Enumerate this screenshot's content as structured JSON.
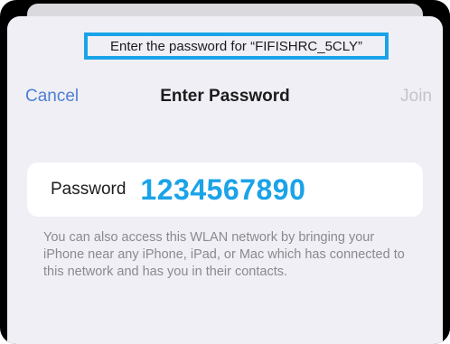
{
  "prompt": {
    "text": "Enter the password for “FIFISHRC_5CLY”"
  },
  "navbar": {
    "cancel_label": "Cancel",
    "title": "Enter Password",
    "join_label": "Join"
  },
  "password_field": {
    "label": "Password",
    "value": "1234567890"
  },
  "footnote": {
    "text": "You can also access this WLAN network by bringing your iPhone near any iPhone, iPad, or Mac which has connected to this network and has you in their contacts."
  },
  "colors": {
    "accent": "#4d7fd3",
    "highlight": "#1aa3e8",
    "disabled": "#c4c4c8",
    "sheet_background": "#f0eff5"
  }
}
